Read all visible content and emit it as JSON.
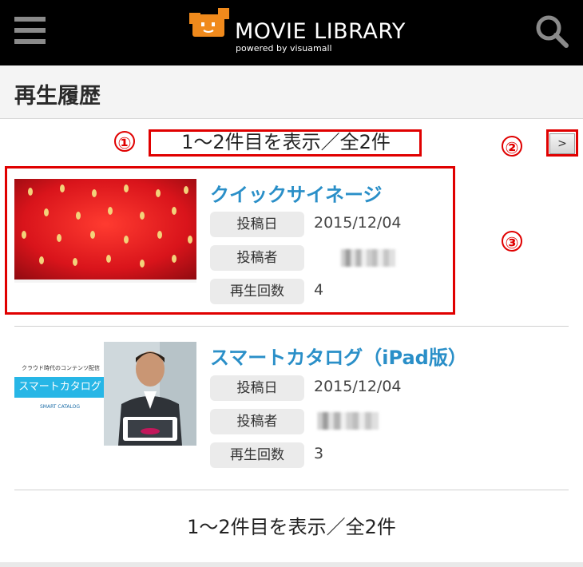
{
  "header": {
    "app_title": "MOVIE LIBRARY",
    "app_subtitle": "powered by visuamall",
    "menu_icon": "hamburger-menu-icon",
    "search_icon": "search-icon",
    "logo_color": "#f08a1c"
  },
  "page": {
    "title": "再生履歴"
  },
  "annotations": {
    "marker_1": "①",
    "marker_2": "②",
    "marker_3": "③",
    "color": "#e00000"
  },
  "pager": {
    "summary_top": "1～2件目を表示／全2件",
    "next_label": ">",
    "summary_bottom": "1～2件目を表示／全2件"
  },
  "videos": [
    {
      "title": "クイックサイネージ",
      "posted_date_label": "投稿日",
      "posted_date": "2015/12/04",
      "poster_label": "投稿者",
      "poster": "",
      "plays_label": "再生回数",
      "plays": "4",
      "thumbnail": "strawberry-thumbnail"
    },
    {
      "title": "スマートカタログ（iPad版）",
      "posted_date_label": "投稿日",
      "posted_date": "2015/12/04",
      "poster_label": "投稿者",
      "poster": "",
      "plays_label": "再生回数",
      "plays": "3",
      "thumbnail": "smart-catalog-thumbnail",
      "thumb_caption_top": "クラウド時代のコンテンツ配信",
      "thumb_banner": "スマートカタログ",
      "thumb_brand": "SMART CATALOG"
    }
  ],
  "colors": {
    "header_bg": "#000000",
    "link_blue": "#2a8fc8",
    "label_bg": "#ebebeb"
  }
}
